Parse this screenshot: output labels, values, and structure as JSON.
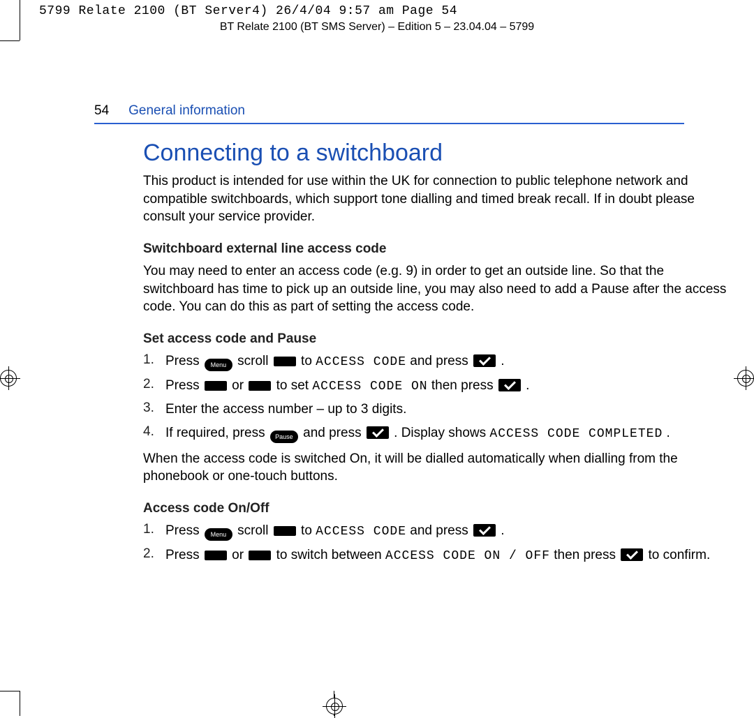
{
  "print_slug": "5799 Relate 2100 (BT Server4)  26/4/04  9:57 am  Page 54",
  "edition_line": "BT Relate 2100 (BT SMS Server) – Edition 5 – 23.04.04 – 5799",
  "page_number": "54",
  "section_name": "General information",
  "title": "Connecting to a switchboard",
  "intro_para": "This product is intended for use within the UK for connection to public telephone network and compatible switchboards, which support tone dialling and timed break recall. If in doubt please consult your service provider.",
  "subhead1": "Switchboard external line access code",
  "para1": "You may need to enter an access code (e.g. 9) in order to get an outside line. So that the switchboard has time to pick up an outside line, you may also need to add a Pause after the access code. You can do this as part of setting the access code.",
  "subhead2": "Set access code and Pause",
  "steps_a": {
    "s1a": "Press ",
    "s1b": " scroll ",
    "s1c": " to ",
    "s1d": "ACCESS CODE",
    "s1e": " and press ",
    "s1f": ".",
    "s2a": "Press ",
    "s2b": " or ",
    "s2c": " to set ",
    "s2d": "ACCESS CODE ON",
    "s2e": " then press ",
    "s2f": ".",
    "s3": "Enter the access number – up to 3 digits.",
    "s4a": "If required, press ",
    "s4b": " and press ",
    "s4c": ". Display shows ",
    "s4d": "ACCESS CODE COMPLETED",
    "s4e": "."
  },
  "follow_para": "When the access code is switched On, it will be dialled automatically when dialling from the phonebook or one-touch buttons.",
  "subhead3": "Access code On/Off",
  "steps_b": {
    "s1a": "Press ",
    "s1b": " scroll ",
    "s1c": " to ",
    "s1d": "ACCESS CODE",
    "s1e": " and press ",
    "s1f": ".",
    "s2a": "Press ",
    "s2b": " or ",
    "s2c": " to switch between ",
    "s2d": "ACCESS CODE ON / OFF",
    "s2e": " then press ",
    "s2f": " to confirm."
  },
  "icons": {
    "menu": "Menu",
    "pause": "Pause"
  },
  "numbers": {
    "n1": "1.",
    "n2": "2.",
    "n3": "3.",
    "n4": "4."
  }
}
